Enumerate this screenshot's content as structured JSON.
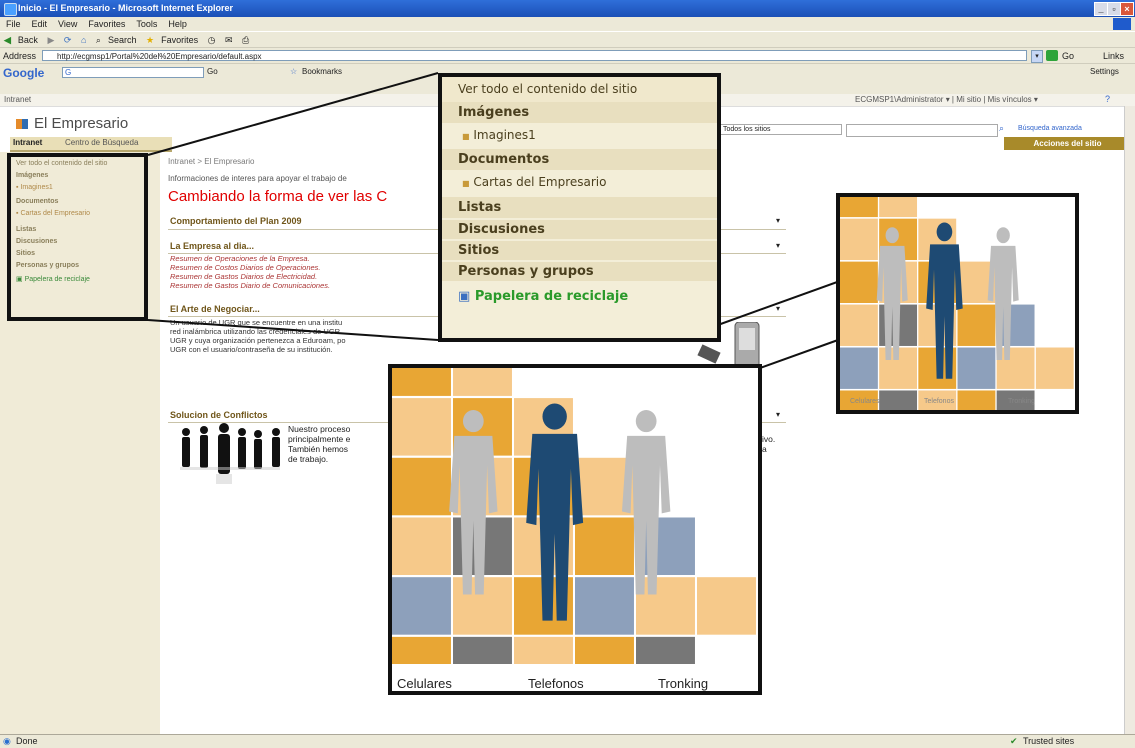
{
  "window": {
    "title": "Inicio - El Empresario - Microsoft Internet Explorer",
    "min": "_",
    "max": "▫",
    "close": "×"
  },
  "menu": [
    "File",
    "Edit",
    "View",
    "Favorites",
    "Tools",
    "Help"
  ],
  "toolbar": {
    "back": "Back",
    "search": "Search",
    "favorites": "Favorites"
  },
  "address": {
    "label": "Address",
    "url": "http://ecgmsp1/Portal%20del%20Empresario/default.aspx",
    "go": "Go",
    "links": "Links"
  },
  "googlebar": {
    "brand": "Google",
    "g_label": "G",
    "settings": "Settings",
    "go_label": "Go",
    "bookmarks": "Bookmarks"
  },
  "site": {
    "intranet": "Intranet",
    "user_links": "ECGMSP1\\Administrator ▾ | Mi sitio | Mis vínculos ▾",
    "title": "El Empresario",
    "tabs": [
      "Intranet",
      "Centro de Búsqueda"
    ],
    "scope": "Todos los sitios",
    "advanced_search": "Búsqueda avanzada",
    "site_actions": "Acciones del sitio",
    "breadcrumb": "Intranet > El Empresario",
    "intro": "Informaciones de interes para apoyar el trabajo de",
    "headline": "Cambiando la forma de ver las C",
    "sections": {
      "plan": "Comportamiento del Plan 2009",
      "empresa": "La Empresa al dia...",
      "empresa_items": [
        "Resumen de Operaciones de la Empresa.",
        "Resumen de Costos Diarios de Operaciones.",
        "Resumen de Gastos Diarios de Electricidad.",
        "Resumen de Gastos Diario de Comunicaciones."
      ],
      "arte": "El Arte de Negociar...",
      "arte_text": [
        "Un usuario de UGR que se encuentre en una institu",
        "red inalámbrica utilizando las credenciales de UGR.",
        "UGR y cuya organización pertenezca a Eduroam, po",
        "UGR con el usuario/contraseña de su institución."
      ],
      "conflictos": "Solucion de Conflictos",
      "conflictos_text": [
        "Nuestro proceso",
        "principalmente e",
        "También hemos",
        "de trabajo."
      ],
      "conflictos_tail": [
        "ivo.",
        "a"
      ]
    }
  },
  "quicklaunch": {
    "view_all": "Ver todo el contenido del sitio",
    "imagenes": "Imágenes",
    "imagenes_items": [
      "Imagines1"
    ],
    "documentos": "Documentos",
    "documentos_items": [
      "Cartas del Empresario"
    ],
    "listas": "Listas",
    "discusiones": "Discusiones",
    "sitios": "Sitios",
    "personas": "Personas y grupos",
    "papelera": "Papelera de reciclaje"
  },
  "image_labels": [
    "Celulares",
    "Telefonos",
    "Tronking"
  ],
  "status": {
    "done": "Done",
    "zone": "Trusted sites"
  },
  "colors": {
    "orange": "#e8a634",
    "light_orange": "#f6c98a",
    "grey": "#777777",
    "steel": "#8da0bb",
    "figure_blue": "#1e4a73",
    "figure_grey": "#bdbdbd",
    "sidebar_bg": "#f0ebd7",
    "callout_bg": "#f3eed8"
  }
}
